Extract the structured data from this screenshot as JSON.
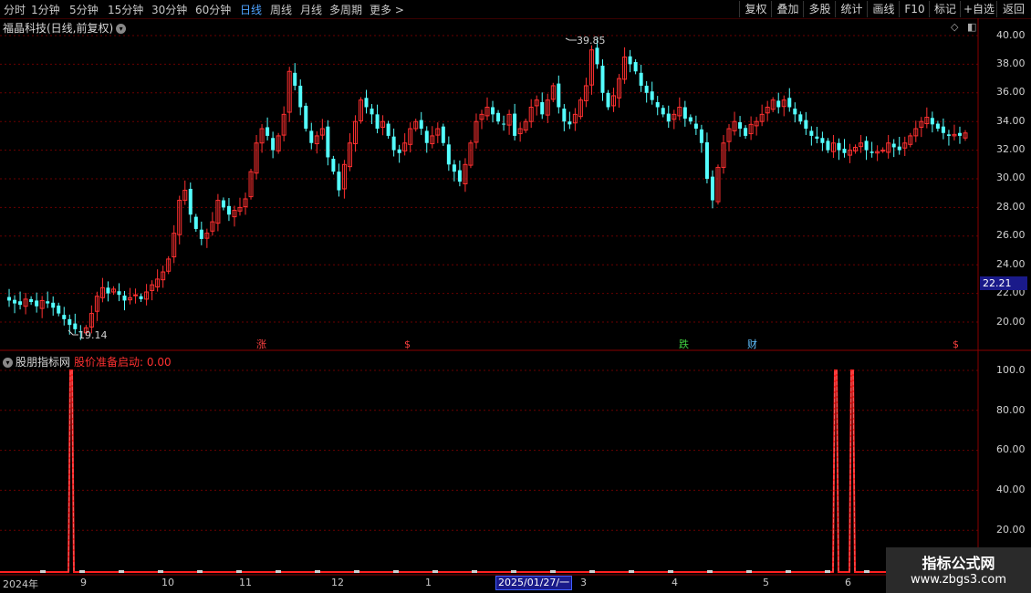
{
  "toolbar": {
    "periods": [
      "分时",
      "1分钟",
      "5分钟",
      "15分钟",
      "30分钟",
      "60分钟",
      "日线",
      "周线",
      "月线",
      "多周期",
      "更多 >"
    ],
    "active_period": "日线",
    "buttons": [
      "复权",
      "叠加",
      "多股",
      "统计",
      "画线",
      "F10",
      "标记",
      "+自选",
      "返回"
    ]
  },
  "main": {
    "stock_title": "福晶科技(日线,前复权)",
    "y_ticks": [
      "40.00",
      "38.00",
      "36.00",
      "34.00",
      "32.00",
      "30.00",
      "28.00",
      "26.00",
      "24.00",
      "22.00",
      "20.00"
    ],
    "current_price": "22.21",
    "high_label": "39.85",
    "low_label": "19.14",
    "markers": [
      {
        "text": "涨",
        "color": "#ff4040"
      },
      {
        "text": "$",
        "color": "#ff4040"
      },
      {
        "text": "跌",
        "color": "#40d040"
      },
      {
        "text": "财",
        "color": "#60c0ff"
      },
      {
        "text": "$",
        "color": "#ff4040"
      }
    ]
  },
  "indicator": {
    "name": "股朋指标网",
    "line_name": "股价准备启动:",
    "value": "0.00",
    "y_ticks": [
      "100.0",
      "80.00",
      "60.00",
      "40.00",
      "20.00"
    ]
  },
  "x_axis": {
    "labels": [
      "2024年",
      "9",
      "10",
      "11",
      "12",
      "1",
      "3",
      "4",
      "5",
      "6"
    ],
    "cursor_date": "2025/01/27/一"
  },
  "watermark": {
    "line1": "指标公式网",
    "line2": "www.zbgs3.com"
  },
  "colors": {
    "up": "#ff3030",
    "down": "#54ffff",
    "signal": "#ff2020",
    "grid": "#6a0000"
  },
  "chart_data": {
    "type": "candlestick",
    "y_range": [
      19,
      40.5
    ],
    "series": [
      {
        "name": "股价准备启动",
        "type": "spike",
        "values_at_peaks": [
          100,
          100,
          100
        ]
      }
    ],
    "price_path": [
      21.8,
      21.5,
      21.3,
      21.2,
      21.6,
      21.4,
      21.1,
      21.5,
      21.3,
      21.0,
      20.6,
      20.2,
      19.8,
      19.5,
      19.3,
      19.6,
      20.6,
      21.8,
      22.4,
      22.0,
      22.3,
      21.9,
      21.5,
      21.7,
      21.9,
      21.6,
      22.1,
      22.6,
      23.0,
      23.5,
      24.4,
      26.2,
      28.5,
      29.2,
      27.5,
      26.5,
      25.8,
      26.2,
      27.0,
      28.5,
      28.0,
      27.5,
      27.8,
      28.0,
      28.6,
      30.5,
      32.5,
      33.5,
      33.0,
      32.0,
      33.0,
      34.5,
      37.5,
      36.5,
      35.0,
      33.5,
      32.5,
      33.0,
      33.5,
      31.5,
      30.5,
      29.2,
      31.0,
      32.5,
      34.0,
      35.5,
      35.0,
      34.5,
      33.5,
      34.0,
      33.0,
      32.0,
      31.8,
      32.5,
      33.5,
      34.0,
      33.5,
      32.5,
      33.0,
      33.5,
      32.5,
      31.0,
      30.5,
      29.8,
      31.0,
      32.5,
      34.0,
      34.5,
      35.0,
      34.5,
      34.0,
      33.8,
      34.5,
      33.0,
      33.5,
      34.0,
      35.0,
      35.5,
      34.5,
      35.5,
      36.5,
      35.0,
      34.0,
      33.8,
      34.5,
      35.5,
      36.5,
      39.0,
      38.0,
      36.0,
      35.0,
      35.8,
      37.0,
      38.5,
      38.0,
      37.5,
      36.5,
      36.0,
      35.5,
      35.0,
      34.5,
      34.0,
      34.5,
      35.0,
      34.2,
      34.0,
      33.5,
      32.5,
      30.0,
      28.5,
      30.8,
      32.5,
      33.5,
      34.0,
      33.5,
      33.0,
      33.8,
      34.0,
      34.5,
      35.0,
      35.5,
      35.0,
      35.5,
      35.0,
      34.5,
      34.0,
      33.5,
      33.0,
      32.8,
      32.5,
      32.0,
      32.5,
      32.0,
      31.8,
      32.0,
      32.2,
      32.5,
      32.0,
      31.8,
      31.9,
      32.0,
      32.5,
      32.2,
      32.0,
      32.5,
      33.0,
      33.5,
      34.0,
      34.3,
      33.8,
      33.5,
      33.2,
      33.0,
      33.1,
      33.0,
      33.2
    ]
  }
}
